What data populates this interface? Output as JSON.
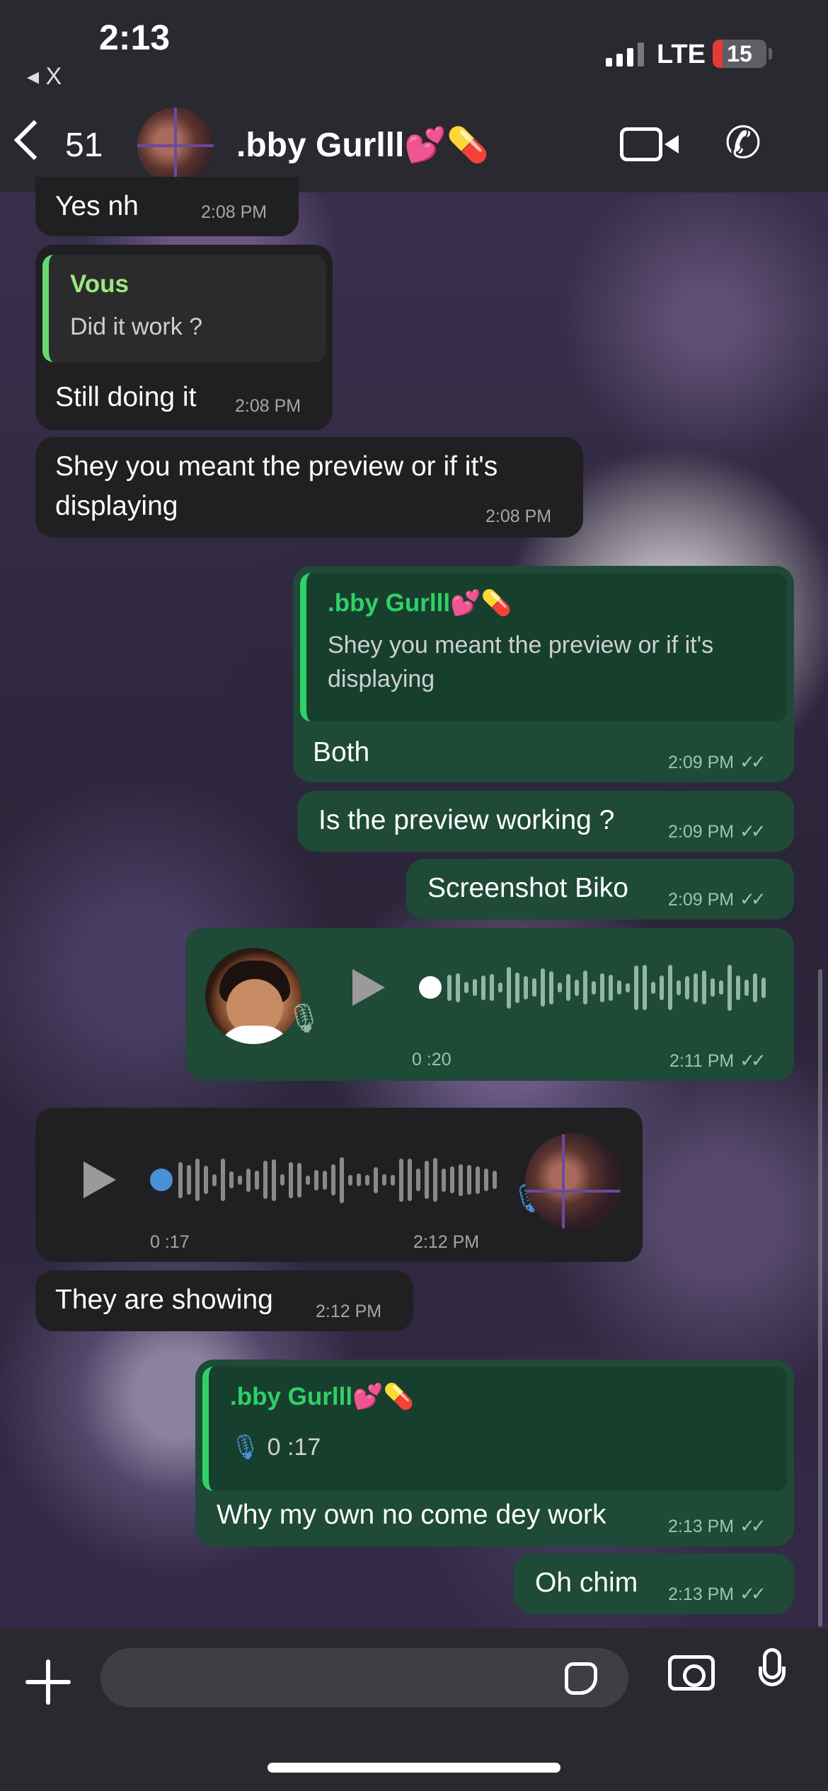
{
  "status_bar": {
    "time": "2:13",
    "back_app": "◂ X",
    "network": "LTE",
    "battery": "15"
  },
  "header": {
    "back_count": "51",
    "contact_name": ".bby Gurlll💕💊"
  },
  "messages": [
    {
      "id": "m1",
      "dir": "in",
      "text": "Yes nh",
      "time": "2:08 PM"
    },
    {
      "id": "m2",
      "dir": "in",
      "quote_name": "Vous",
      "quote_text": "Did it work ?",
      "text": "Still doing it",
      "time": "2:08 PM"
    },
    {
      "id": "m3",
      "dir": "in",
      "text_line1": "Shey you meant the preview or if it's",
      "text_line2": "displaying",
      "time": "2:08 PM"
    },
    {
      "id": "m4",
      "dir": "out",
      "quote_name": ".bby Gurlll💕💊",
      "quote_line1": "Shey you meant the preview or if it's",
      "quote_line2": "displaying",
      "text": "Both",
      "time": "2:09 PM"
    },
    {
      "id": "m5",
      "dir": "out",
      "text": "Is the preview working ?",
      "time": "2:09 PM"
    },
    {
      "id": "m6",
      "dir": "out",
      "text": "Screenshot Biko",
      "time": "2:09 PM"
    },
    {
      "id": "m7",
      "dir": "out",
      "type": "voice",
      "duration": "0 :20",
      "time": "2:11 PM",
      "progress": 0
    },
    {
      "id": "m8",
      "dir": "in",
      "type": "voice",
      "duration": "0 :17",
      "time": "2:12 PM",
      "progress": 0
    },
    {
      "id": "m9",
      "dir": "in",
      "text": "They are showing",
      "time": "2:12 PM"
    },
    {
      "id": "m10",
      "dir": "out",
      "quote_name": ".bby Gurlll💕💊",
      "quote_voice": "0 :17",
      "text": "Why my own no come dey work",
      "time": "2:13 PM"
    },
    {
      "id": "m11",
      "dir": "out",
      "text": "Oh chim",
      "time": "2:13 PM"
    }
  ],
  "read_ticks": "✓✓",
  "colors": {
    "header_bg": "#2a2930",
    "incoming_bubble": "#202022",
    "outgoing_bubble": "#1e4a37",
    "quote_accent_out": "#2fd167",
    "quote_accent_in": "#66d86e",
    "voice_blue": "#4a90d9"
  },
  "icons": [
    "back-chevron-icon",
    "video-call-icon",
    "phone-call-icon",
    "plus-icon",
    "sticker-icon",
    "camera-icon",
    "microphone-icon",
    "play-icon"
  ]
}
